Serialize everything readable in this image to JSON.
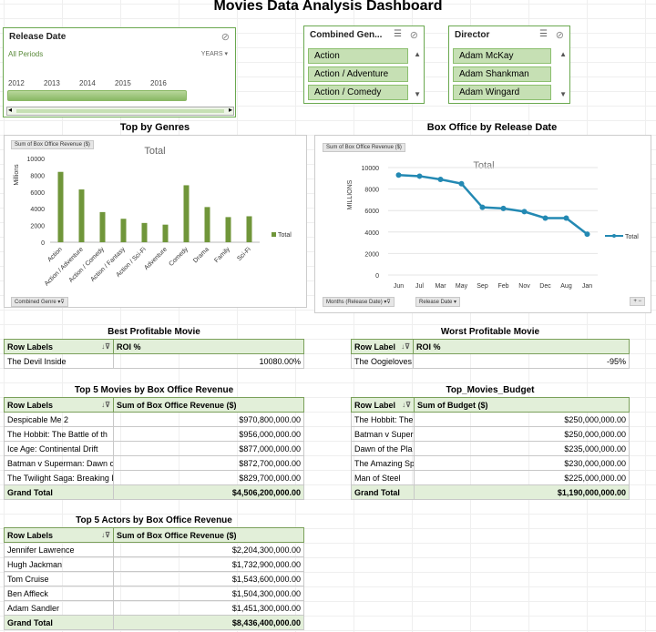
{
  "title": "Movies Data Analysis Dashboard",
  "slicers": {
    "release_date": {
      "header": "Release Date",
      "periods": "All Periods",
      "level": "YEARS",
      "years": [
        "2012",
        "2013",
        "2014",
        "2015",
        "2016"
      ]
    },
    "genre": {
      "header": "Combined Gen...",
      "items": [
        "Action",
        "Action / Adventure",
        "Action / Comedy"
      ]
    },
    "director": {
      "header": "Director",
      "items": [
        "Adam McKay",
        "Adam Shankman",
        "Adam Wingard"
      ]
    }
  },
  "charts_meta": {
    "genres_section_title": "Top by Genres",
    "genres_field_button": "Sum of Box Office Revenue ($)",
    "genres_axis_field": "Combined Genre",
    "genres_unit": "Millions",
    "box_section_title": "Box Office by Release Date",
    "box_field_button": "Sum of Box Office Revenue ($)",
    "box_axis_field_1": "Months (Release Date)",
    "box_axis_field_2": "Release Date",
    "box_unit": "MILLIONS"
  },
  "chart_data": [
    {
      "type": "bar",
      "title": "Total",
      "ylabel": "Millions",
      "categories": [
        "Action",
        "Action / Adventure",
        "Action / Comedy",
        "Action / Fantasy",
        "Action / Sci-Fi",
        "Adventure",
        "Comedy",
        "Drama",
        "Family",
        "Sci-Fi"
      ],
      "series": [
        {
          "name": "Total",
          "values": [
            8400,
            6300,
            3600,
            2800,
            2300,
            2100,
            6800,
            4200,
            3000,
            3100
          ]
        }
      ],
      "yticks": [
        "0",
        "2000",
        "4000",
        "6000",
        "8000",
        "10000"
      ],
      "ylim": [
        0,
        10000
      ],
      "legend": "right",
      "color": "#70963a"
    },
    {
      "type": "line",
      "title": "Total",
      "ylabel": "MILLIONS",
      "categories": [
        "Jun",
        "Jul",
        "Mar",
        "May",
        "Sep",
        "Feb",
        "Nov",
        "Dec",
        "Aug",
        "Jan"
      ],
      "series": [
        {
          "name": "Total",
          "values": [
            9300,
            9200,
            8900,
            8500,
            6300,
            6200,
            5900,
            5300,
            5300,
            3800
          ]
        }
      ],
      "yticks": [
        "0",
        "2000",
        "4000",
        "6000",
        "8000",
        "10000"
      ],
      "ylim": [
        0,
        10000
      ],
      "legend": "right",
      "color": "#2389b3"
    }
  ],
  "best": {
    "title": "Best Profitable Movie",
    "col1": "Row Labels",
    "col2": "ROI %",
    "row": {
      "label": "The Devil Inside",
      "value": "10080.00%"
    }
  },
  "worst": {
    "title": "Worst Profitable Movie",
    "col1": "Row Label",
    "col2": "ROI %",
    "row": {
      "label": "The Oogieloves",
      "value": "-95%"
    }
  },
  "top_movies": {
    "title": "Top 5 Movies by Box Office Revenue",
    "col1": "Row Labels",
    "col2": "Sum of Box Office Revenue ($)",
    "rows": [
      {
        "label": "Despicable Me 2",
        "value": "$970,800,000.00"
      },
      {
        "label": "The Hobbit: The Battle of th",
        "value": "$956,000,000.00"
      },
      {
        "label": "Ice Age: Continental Drift",
        "value": "$877,000,000.00"
      },
      {
        "label": "Batman v Superman: Dawn o",
        "value": "$872,700,000.00"
      },
      {
        "label": "The Twilight Saga: Breaking D",
        "value": "$829,700,000.00"
      }
    ],
    "total_label": "Grand Total",
    "total_value": "$4,506,200,000.00"
  },
  "top_budget": {
    "title": "Top_Movies_Budget",
    "col1": "Row Label",
    "col2": "Sum of Budget ($)",
    "rows": [
      {
        "label": "The Hobbit: The",
        "value": "$250,000,000.00"
      },
      {
        "label": "Batman v Superm",
        "value": "$250,000,000.00"
      },
      {
        "label": "Dawn of the Pla",
        "value": "$235,000,000.00"
      },
      {
        "label": "The Amazing Spi",
        "value": "$230,000,000.00"
      },
      {
        "label": "Man of Steel",
        "value": "$225,000,000.00"
      }
    ],
    "total_label": "Grand Total",
    "total_value": "$1,190,000,000.00"
  },
  "top_actors": {
    "title": "Top 5 Actors by Box Office Revenue",
    "col1": "Row Labels",
    "col2": "Sum of Box Office Revenue ($)",
    "rows": [
      {
        "label": "Jennifer Lawrence",
        "value": "$2,204,300,000.00"
      },
      {
        "label": "Hugh Jackman",
        "value": "$1,732,900,000.00"
      },
      {
        "label": "Tom Cruise",
        "value": "$1,543,600,000.00"
      },
      {
        "label": "Ben Affleck",
        "value": "$1,504,300,000.00"
      },
      {
        "label": "Adam Sandler",
        "value": "$1,451,300,000.00"
      }
    ],
    "total_label": "Grand Total",
    "total_value": "$8,436,400,000.00"
  }
}
